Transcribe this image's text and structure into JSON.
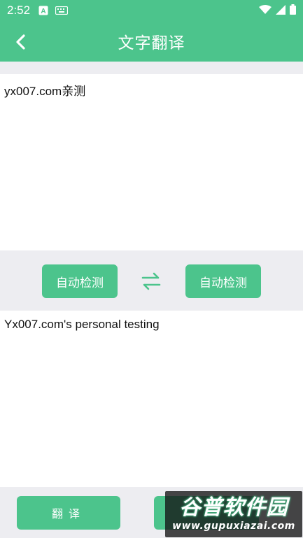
{
  "status_bar": {
    "time": "2:52",
    "icons": [
      "a-badge-icon",
      "keyboard-icon",
      "wifi-icon",
      "cell-signal-icon",
      "battery-icon"
    ]
  },
  "app_bar": {
    "title": "文字翻译",
    "back_icon": "chevron-left-icon"
  },
  "source": {
    "text": "yx007.com亲测"
  },
  "languages": {
    "from_label": "自动检测",
    "to_label": "自动检测",
    "swap_icon": "swap-arrows-icon"
  },
  "result": {
    "text": "Yx007.com's personal testing"
  },
  "bottom": {
    "translate_label": "翻译",
    "second_label": ""
  },
  "watermark": {
    "title": "谷普软件园",
    "url": "www.gupuxiazai.com"
  },
  "colors": {
    "accent": "#4cc48c",
    "background": "#ededf1",
    "panel": "#ffffff"
  }
}
